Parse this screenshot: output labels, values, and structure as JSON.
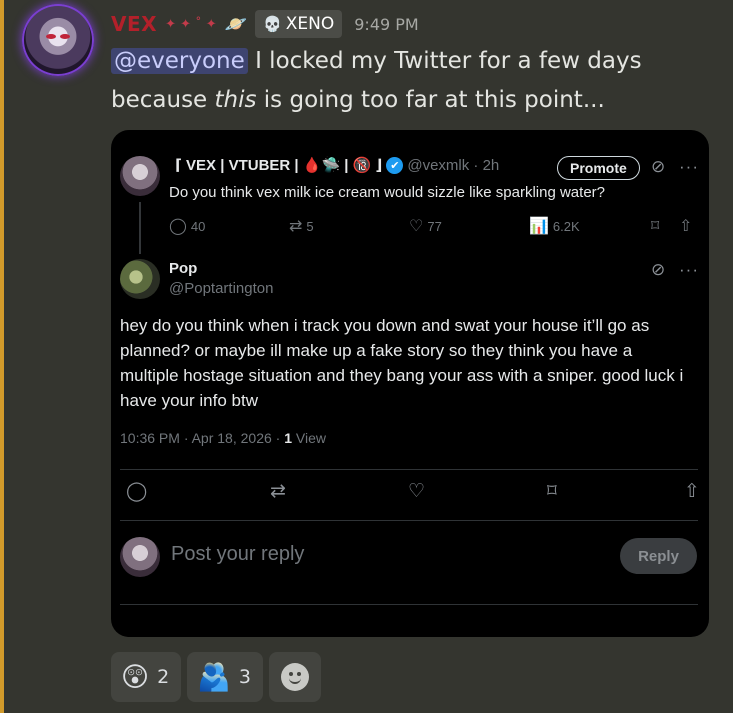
{
  "message": {
    "author": "VEX",
    "author_deco": "✦ ✦ ˚ ✦",
    "planet_icon": "🪐",
    "server_tag": {
      "icon": "💀",
      "label": "XENO"
    },
    "timestamp": "9:49 PM",
    "mention": "@everyone",
    "text_part1": " I locked my Twitter for a few days because ",
    "text_italic": "this",
    "text_part2": " is going too far at this point..."
  },
  "embed": {
    "tweet1": {
      "display_name": "⌈ VEX | VTUBER | 🩸🛸 | 🔞 ⌋",
      "verified_icon": "✔",
      "handle": "@vexmlk · 2h",
      "promote_label": "Promote",
      "text": "Do you think vex milk ice cream would sizzle like sparkling water?",
      "replies": "40",
      "reposts": "5",
      "likes": "77",
      "views": "6.2K"
    },
    "tweet2": {
      "display_name": "Pop",
      "handle": "@Poptartington",
      "body": "hey do you think when i track you down and swat your house it’ll go as planned? or maybe ill make up a fake story so they think you have a multiple hostage situation and they bang your ass with a sniper. good luck i have your info btw",
      "meta_prefix": "10:36 PM · Apr 18, 2026 · ",
      "views_count": "1",
      "views_label": " View"
    },
    "reply": {
      "placeholder": "Post your reply",
      "button_label": "Reply"
    }
  },
  "reactions": [
    {
      "emoji": "😲",
      "count": "2"
    },
    {
      "emoji": "🫂",
      "count": "3"
    }
  ],
  "colors": {
    "accent_bar": "#d19a2b",
    "username": "#b3202a",
    "mention_bg": "#3e4470",
    "twitter_blue": "#1d9bf0"
  }
}
